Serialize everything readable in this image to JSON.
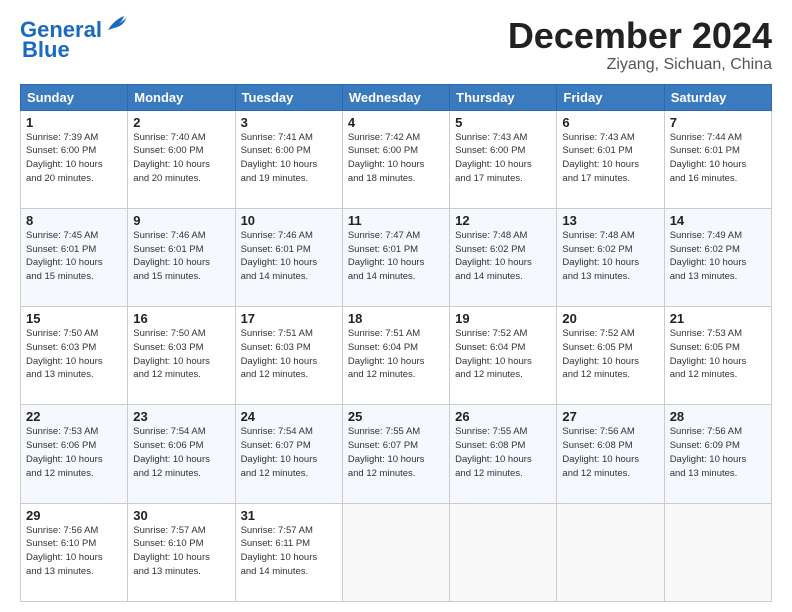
{
  "logo": {
    "line1": "General",
    "line2": "Blue"
  },
  "title": "December 2024",
  "location": "Ziyang, Sichuan, China",
  "days_of_week": [
    "Sunday",
    "Monday",
    "Tuesday",
    "Wednesday",
    "Thursday",
    "Friday",
    "Saturday"
  ],
  "weeks": [
    [
      {
        "day": "1",
        "info": "Sunrise: 7:39 AM\nSunset: 6:00 PM\nDaylight: 10 hours\nand 20 minutes."
      },
      {
        "day": "2",
        "info": "Sunrise: 7:40 AM\nSunset: 6:00 PM\nDaylight: 10 hours\nand 20 minutes."
      },
      {
        "day": "3",
        "info": "Sunrise: 7:41 AM\nSunset: 6:00 PM\nDaylight: 10 hours\nand 19 minutes."
      },
      {
        "day": "4",
        "info": "Sunrise: 7:42 AM\nSunset: 6:00 PM\nDaylight: 10 hours\nand 18 minutes."
      },
      {
        "day": "5",
        "info": "Sunrise: 7:43 AM\nSunset: 6:00 PM\nDaylight: 10 hours\nand 17 minutes."
      },
      {
        "day": "6",
        "info": "Sunrise: 7:43 AM\nSunset: 6:01 PM\nDaylight: 10 hours\nand 17 minutes."
      },
      {
        "day": "7",
        "info": "Sunrise: 7:44 AM\nSunset: 6:01 PM\nDaylight: 10 hours\nand 16 minutes."
      }
    ],
    [
      {
        "day": "8",
        "info": "Sunrise: 7:45 AM\nSunset: 6:01 PM\nDaylight: 10 hours\nand 15 minutes."
      },
      {
        "day": "9",
        "info": "Sunrise: 7:46 AM\nSunset: 6:01 PM\nDaylight: 10 hours\nand 15 minutes."
      },
      {
        "day": "10",
        "info": "Sunrise: 7:46 AM\nSunset: 6:01 PM\nDaylight: 10 hours\nand 14 minutes."
      },
      {
        "day": "11",
        "info": "Sunrise: 7:47 AM\nSunset: 6:01 PM\nDaylight: 10 hours\nand 14 minutes."
      },
      {
        "day": "12",
        "info": "Sunrise: 7:48 AM\nSunset: 6:02 PM\nDaylight: 10 hours\nand 14 minutes."
      },
      {
        "day": "13",
        "info": "Sunrise: 7:48 AM\nSunset: 6:02 PM\nDaylight: 10 hours\nand 13 minutes."
      },
      {
        "day": "14",
        "info": "Sunrise: 7:49 AM\nSunset: 6:02 PM\nDaylight: 10 hours\nand 13 minutes."
      }
    ],
    [
      {
        "day": "15",
        "info": "Sunrise: 7:50 AM\nSunset: 6:03 PM\nDaylight: 10 hours\nand 13 minutes."
      },
      {
        "day": "16",
        "info": "Sunrise: 7:50 AM\nSunset: 6:03 PM\nDaylight: 10 hours\nand 12 minutes."
      },
      {
        "day": "17",
        "info": "Sunrise: 7:51 AM\nSunset: 6:03 PM\nDaylight: 10 hours\nand 12 minutes."
      },
      {
        "day": "18",
        "info": "Sunrise: 7:51 AM\nSunset: 6:04 PM\nDaylight: 10 hours\nand 12 minutes."
      },
      {
        "day": "19",
        "info": "Sunrise: 7:52 AM\nSunset: 6:04 PM\nDaylight: 10 hours\nand 12 minutes."
      },
      {
        "day": "20",
        "info": "Sunrise: 7:52 AM\nSunset: 6:05 PM\nDaylight: 10 hours\nand 12 minutes."
      },
      {
        "day": "21",
        "info": "Sunrise: 7:53 AM\nSunset: 6:05 PM\nDaylight: 10 hours\nand 12 minutes."
      }
    ],
    [
      {
        "day": "22",
        "info": "Sunrise: 7:53 AM\nSunset: 6:06 PM\nDaylight: 10 hours\nand 12 minutes."
      },
      {
        "day": "23",
        "info": "Sunrise: 7:54 AM\nSunset: 6:06 PM\nDaylight: 10 hours\nand 12 minutes."
      },
      {
        "day": "24",
        "info": "Sunrise: 7:54 AM\nSunset: 6:07 PM\nDaylight: 10 hours\nand 12 minutes."
      },
      {
        "day": "25",
        "info": "Sunrise: 7:55 AM\nSunset: 6:07 PM\nDaylight: 10 hours\nand 12 minutes."
      },
      {
        "day": "26",
        "info": "Sunrise: 7:55 AM\nSunset: 6:08 PM\nDaylight: 10 hours\nand 12 minutes."
      },
      {
        "day": "27",
        "info": "Sunrise: 7:56 AM\nSunset: 6:08 PM\nDaylight: 10 hours\nand 12 minutes."
      },
      {
        "day": "28",
        "info": "Sunrise: 7:56 AM\nSunset: 6:09 PM\nDaylight: 10 hours\nand 13 minutes."
      }
    ],
    [
      {
        "day": "29",
        "info": "Sunrise: 7:56 AM\nSunset: 6:10 PM\nDaylight: 10 hours\nand 13 minutes."
      },
      {
        "day": "30",
        "info": "Sunrise: 7:57 AM\nSunset: 6:10 PM\nDaylight: 10 hours\nand 13 minutes."
      },
      {
        "day": "31",
        "info": "Sunrise: 7:57 AM\nSunset: 6:11 PM\nDaylight: 10 hours\nand 14 minutes."
      },
      null,
      null,
      null,
      null
    ]
  ]
}
